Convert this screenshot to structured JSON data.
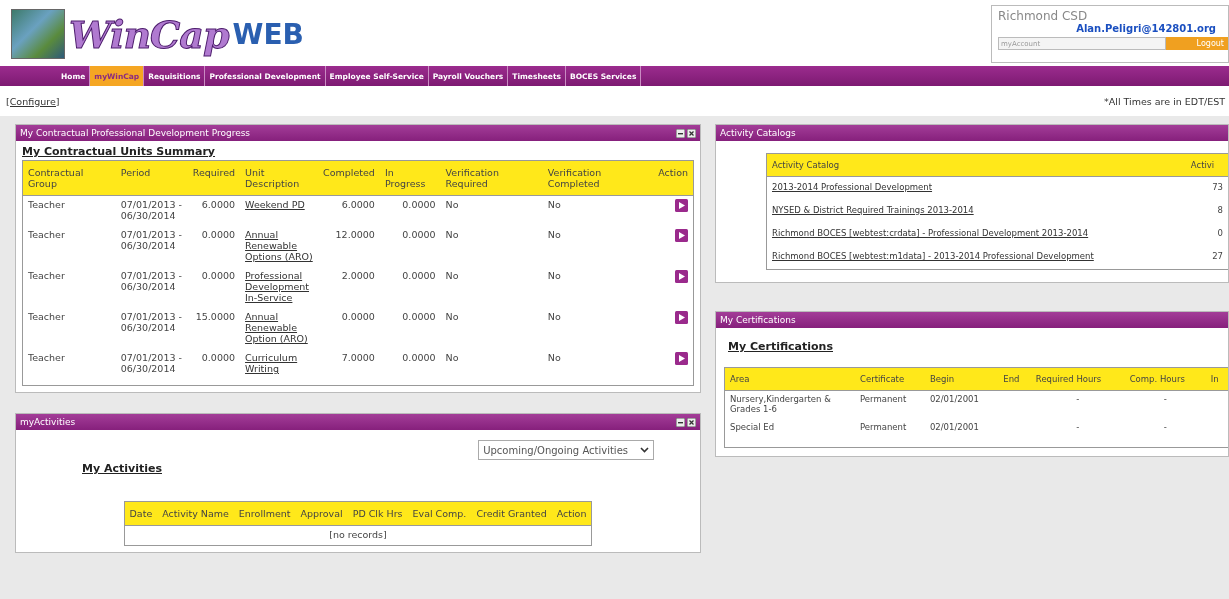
{
  "header": {
    "logo_main": "WinCap",
    "logo_accent": "WEB",
    "district": "Richmond CSD",
    "email": "Alan.Peligri@142801.org",
    "account_field": {
      "value": "myAccount"
    },
    "logout": "Logout"
  },
  "nav": [
    {
      "label": "Home",
      "selected": false
    },
    {
      "label": "myWinCap",
      "selected": true
    },
    {
      "label": "Requisitions",
      "selected": false
    },
    {
      "label": "Professional Development",
      "selected": false
    },
    {
      "label": "Employee Self-Service",
      "selected": false
    },
    {
      "label": "Payroll Vouchers",
      "selected": false
    },
    {
      "label": "Timesheets",
      "selected": false
    },
    {
      "label": "BOCES Services",
      "selected": false
    }
  ],
  "toolbar": {
    "configure": "[Configure]",
    "time_note": "*All Times are in EDT/EST"
  },
  "units_panel": {
    "title": "My Contractual Professional Development Progress",
    "heading": "My Contractual Units Summary",
    "columns": [
      "Contractual Group",
      "Period",
      "Required",
      "Unit Description",
      "Completed",
      "In Progress",
      "Verification Required",
      "Verification Completed",
      "Action"
    ],
    "rows": [
      {
        "group": "Teacher",
        "period": "07/01/2013 - 06/30/2014",
        "required": "6.0000",
        "unit": "Weekend PD",
        "completed": "6.0000",
        "in_progress": "0.0000",
        "verification_required": "No",
        "verification_completed": "No"
      },
      {
        "group": "Teacher",
        "period": "07/01/2013 - 06/30/2014",
        "required": "0.0000",
        "unit": "Annual Renewable Options (ARO)",
        "completed": "12.0000",
        "in_progress": "0.0000",
        "verification_required": "No",
        "verification_completed": "No"
      },
      {
        "group": "Teacher",
        "period": "07/01/2013 - 06/30/2014",
        "required": "0.0000",
        "unit": "Professional Development In-Service",
        "completed": "2.0000",
        "in_progress": "0.0000",
        "verification_required": "No",
        "verification_completed": "No"
      },
      {
        "group": "Teacher",
        "period": "07/01/2013 - 06/30/2014",
        "required": "15.0000",
        "unit": "Annual Renewable Option (ARO)",
        "completed": "0.0000",
        "in_progress": "0.0000",
        "verification_required": "No",
        "verification_completed": "No"
      },
      {
        "group": "Teacher",
        "period": "07/01/2013 - 06/30/2014",
        "required": "0.0000",
        "unit": "Curriculum Writing",
        "completed": "7.0000",
        "in_progress": "0.0000",
        "verification_required": "No",
        "verification_completed": "No"
      }
    ]
  },
  "activities_panel": {
    "title": "myActivities",
    "filter": "Upcoming/Ongoing Activities",
    "heading": "My Activities",
    "columns": [
      "Date",
      "Activity Name",
      "Enrollment",
      "Approval",
      "PD Clk Hrs",
      "Eval Comp.",
      "Credit Granted",
      "Action"
    ],
    "empty_text": "[no records]"
  },
  "catalog_panel": {
    "title": "Activity Catalogs",
    "columns": [
      "Activity Catalog",
      "Activi"
    ],
    "rows": [
      {
        "name": "2013-2014 Professional Development",
        "count": "73"
      },
      {
        "name": "NYSED & District Required Trainings 2013-2014",
        "count": "8"
      },
      {
        "name": "Richmond BOCES [webtest:crdata] - Professional Development 2013-2014",
        "count": "0"
      },
      {
        "name": "Richmond BOCES [webtest:m1data] - 2013-2014 Professional Development",
        "count": "27"
      }
    ]
  },
  "certifications_panel": {
    "title": "My Certifications",
    "heading": "My Certifications",
    "columns": [
      "Area",
      "Certificate",
      "Begin",
      "End",
      "Required Hours",
      "Comp. Hours",
      "In"
    ],
    "rows": [
      {
        "area": "Nursery,Kindergarten & Grades 1-6",
        "certificate": "Permanent",
        "begin": "02/01/2001",
        "required_hours": "-",
        "comp_hours": "-"
      },
      {
        "area": "Special Ed",
        "certificate": "Permanent",
        "begin": "02/01/2001",
        "required_hours": "-",
        "comp_hours": "-"
      }
    ]
  }
}
